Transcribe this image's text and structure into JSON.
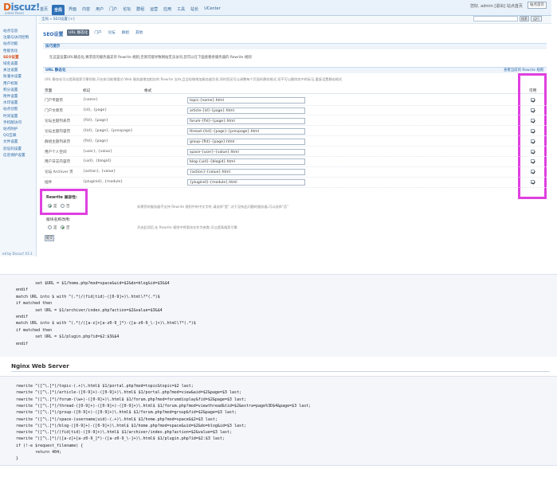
{
  "header": {
    "logo_main": "iscuz!",
    "logo_prefix": "D",
    "logo_sub": "ontrol Panel",
    "nav": [
      "首页",
      "全局",
      "界面",
      "内容",
      "用户",
      "门户",
      "论坛",
      "群组",
      "运营",
      "应用",
      "工具",
      "站长",
      "UCenter"
    ],
    "active_nav_index": 1,
    "user_info": "您好, admin [退出] 站点首页",
    "exit_label": "站点首页"
  },
  "subbar": {
    "breadcrumb": "全局 » SEO设置 [+]",
    "search_button": "搜索",
    "right_button": "运行"
  },
  "sidebar": {
    "items": [
      "站点信息",
      "注册与访问控制",
      "站点功能",
      "性能优化",
      "SEO设置",
      "域名设置",
      "关注设置",
      "防灌水设置",
      "用户权限",
      "积分设置",
      "附件设置",
      "水印设置",
      "站点创客",
      "时间设置",
      "手机版访问",
      "站点防护",
      "QQ互联",
      "文件设置",
      "验证码设置",
      "信息保护设置"
    ],
    "active_index": 4,
    "footer": "ed by Discuz! X3.3"
  },
  "main": {
    "title": "SEO设置",
    "tabs": [
      "URL 静态化",
      "门户",
      "论坛",
      "群组",
      "其他"
    ],
    "active_tab": 0,
    "tips_header": "技巧提示",
    "tip": "在这里设置URL静态化,要求您的服务器支持 Rewrite 规则,否则可能导致网站无法访问,您可以在下面查看各服务器的 Rewrite 规则",
    "url_section": "URL 静态化",
    "show_rules_link": "查看当前的 Rewrite 规则",
    "url_note": "URL 静态化可以提高搜索引擎抓取,开启本功能需要对 Web 服务器增加相应的 Rewrite 支持,且会轻微增加服务器负担,同时您还可以调整每个页面的静态格式,但不可以删除其中的标记,重复设置静态格式",
    "columns": [
      "页面",
      "标记",
      "格式",
      "可用"
    ],
    "rows": [
      {
        "page": "门户专题页",
        "marks": "{name}",
        "format": "topic-{name}.html"
      },
      {
        "page": "门户文章页",
        "marks": "{id}, {page}",
        "format": "article-{id}-{page}.html"
      },
      {
        "page": "论坛主题列表页",
        "marks": "{fid}, {page}",
        "format": "forum-{fid}-{page}.html"
      },
      {
        "page": "论坛主题内容页",
        "marks": "{tid}, {page}, {prevpage}",
        "format": "thread-{tid}-{page}-{prevpage}.html"
      },
      {
        "page": "群组主题列表页",
        "marks": "{fid}, {page}",
        "format": "group-{fid}-{page}.html"
      },
      {
        "page": "用户个人空间",
        "marks": "{user}, {value}",
        "format": "space-{user}-{value}.html"
      },
      {
        "page": "用户日志内容页",
        "marks": "{uid}, {blogid}",
        "format": "blog-{uid}-{blogid}.html"
      },
      {
        "page": "论坛 Archiver 页",
        "marks": "{action}, {value}",
        "format": "{action}-{value}.html"
      },
      {
        "page": "插件",
        "marks": "{pluginid}, {module}",
        "format": "{pluginid}-{module}.html"
      }
    ],
    "rewrite_label": "Rewrite 兼容性:",
    "rewrite_yes": "是",
    "rewrite_no": "否",
    "rewrite_note": "如果您的服务器不支持 Rewrite 规则中的中文字符,请选择“是”,对于没有此问题的服务器,可以选择“否”",
    "bbs_label": "版块名称改用:",
    "bbs_yes": "是",
    "bbs_no": "否",
    "bbs_note": "开启此项后,在 Rewrite 规则中将版块名作为参数,可以提高搜索引擎",
    "submit_label": "提交"
  },
  "code_block_1": [
    "        set $URL = $1/home.php?mod=space&uid=$2&do=blog&id=$3&$4",
    "endif",
    "match URL into $ with ^(.*)/(fid|tid)-([0-9]+)\\.html\\?*(.*)$",
    "if matched then",
    "        set URL = $1/archiver/index.php?action=$2&value=$3&$4",
    "endif",
    "match URL into $ with ^(.*)/([a-z]+[a-z0-9_]*)-([a-z0-9_\\-]+)\\.html\\?*(.*)$",
    "if matched then",
    "        set URL = $1/plugin.php?id=$2:$3&$4",
    "endif"
  ],
  "nginx_title": "Nginx Web Server",
  "code_block_2": [
    "rewrite ^([^\\.]*)/topic-(.+)\\.html$ $1/portal.php?mod=topic&topic=$2 last;",
    "rewrite ^([^\\.]*)/article-([0-9]+)-([0-9]+)\\.html$ $1/portal.php?mod=view&aid=$2&page=$3 last;",
    "rewrite ^([^\\.]*)/forum-(\\w+)-([0-9]+)\\.html$ $1/forum.php?mod=forumdisplay&fid=$2&page=$3 last;",
    "rewrite ^([^\\.]*)/thread-([0-9]+)-([0-9]+)-([0-9]+)\\.html$ $1/forum.php?mod=viewthread&tid=$2&extra=page%3D$4&page=$3 last;",
    "rewrite ^([^\\.]*)/group-([0-9]+)-([0-9]+)\\.html$ $1/forum.php?mod=group&fid=$2&page=$3 last;",
    "rewrite ^([^\\.]*)/space-(username|uid)-(.+)\\.html$ $1/home.php?mod=space&$2=$3 last;",
    "rewrite ^([^\\.]*)/blog-([0-9]+)-([0-9]+)\\.html$ $1/home.php?mod=space&uid=$2&do=blog&id=$3 last;",
    "rewrite ^([^\\.]*)/(fid|tid)-([0-9]+)\\.html$ $1/archiver/index.php?action=$2&value=$3 last;",
    "rewrite ^([^\\.]*)/([a-z]+[a-z0-9_]*)-([a-z0-9_\\-]+)\\.html$ $1/plugin.php?id=$2:$3 last;",
    "if (!-e $request_filename) {",
    "        return 404;",
    "}"
  ],
  "colors": {
    "highlight": "#e040e0",
    "accent": "#2f71b7",
    "header_bg": "#e9f2fa"
  }
}
